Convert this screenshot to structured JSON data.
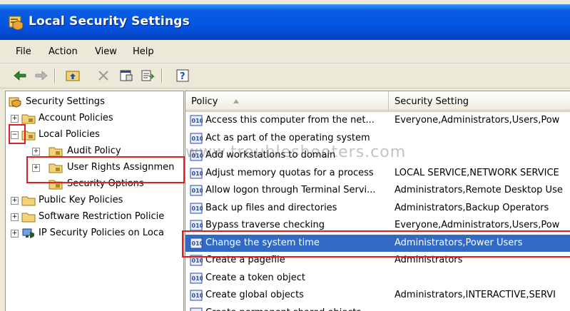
{
  "window": {
    "title": "Local Security Settings",
    "title_icon": "security-settings-icon"
  },
  "menu": [
    "File",
    "Action",
    "View",
    "Help"
  ],
  "toolbar": {
    "buttons": [
      "back-arrow-icon",
      "forward-arrow-icon",
      "up-folder-icon",
      "delete-x-icon",
      "properties-icon",
      "export-list-icon",
      "help-icon"
    ]
  },
  "tree": {
    "root": "Security Settings",
    "items": [
      {
        "label": "Account Policies",
        "expander": "+"
      },
      {
        "label": "Local Policies",
        "expander": "−"
      },
      {
        "label": "Audit Policy",
        "expander": "+"
      },
      {
        "label": "User Rights Assignmen",
        "expander": "+"
      },
      {
        "label": "Security Options",
        "expander": ""
      },
      {
        "label": "Public Key Policies",
        "expander": "+"
      },
      {
        "label": "Software Restriction Policie",
        "expander": "+"
      },
      {
        "label": "IP Security Policies on Loca",
        "expander": "+"
      }
    ]
  },
  "list": {
    "columns": [
      "Policy",
      "Security Setting"
    ],
    "rows": [
      {
        "policy": "Access this computer from the net...",
        "setting": "Everyone,Administrators,Users,Pow"
      },
      {
        "policy": "Act as part of the operating system",
        "setting": ""
      },
      {
        "policy": "Add workstations to domain",
        "setting": ""
      },
      {
        "policy": "Adjust memory quotas for a process",
        "setting": "LOCAL SERVICE,NETWORK SERVICE"
      },
      {
        "policy": "Allow logon through Terminal Servi...",
        "setting": "Administrators,Remote Desktop Use"
      },
      {
        "policy": "Back up files and directories",
        "setting": "Administrators,Backup Operators"
      },
      {
        "policy": "Bypass traverse checking",
        "setting": "Everyone,Administrators,Users,Pow"
      },
      {
        "policy": "Change the system time",
        "setting": "Administrators,Power Users"
      },
      {
        "policy": "Create a pagefile",
        "setting": "Administrators"
      },
      {
        "policy": "Create a token object",
        "setting": ""
      },
      {
        "policy": "Create global objects",
        "setting": "Administrators,INTERACTIVE,SERVI"
      },
      {
        "policy": "Create permanent shared objects",
        "setting": ""
      }
    ],
    "selected_index": 7
  },
  "watermark": "www.troubleshooters.com",
  "colors": {
    "selection": "#316ac5",
    "highlight_box": "#e02020",
    "title_bar": "#0554e3"
  }
}
